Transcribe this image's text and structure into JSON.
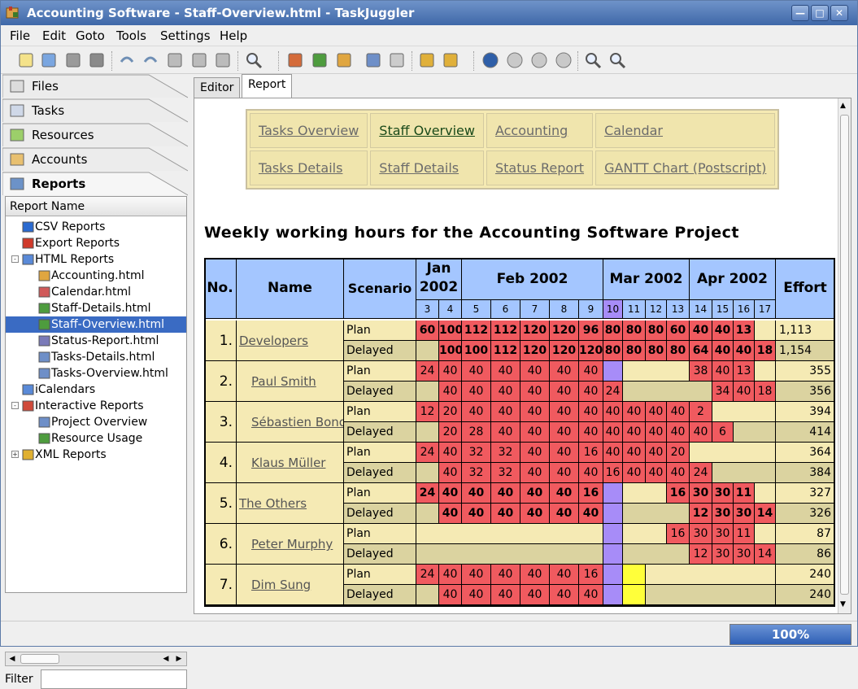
{
  "window": {
    "title": "Accounting Software - Staff-Overview.html - TaskJuggler",
    "buttons": [
      "—",
      "□",
      "✕"
    ]
  },
  "menu": [
    "File",
    "Edit",
    "Goto",
    "Tools",
    "Settings",
    "Help"
  ],
  "toolbar_icons": [
    "new-file",
    "open-file",
    "save",
    "print",
    "undo",
    "redo",
    "cut",
    "copy",
    "paste",
    "find",
    "tasks-view",
    "resources-view",
    "accounts-view",
    "report-view",
    "copy-report",
    "configure",
    "calendar",
    "schedule",
    "stop",
    "back",
    "forward",
    "zoom-in",
    "zoom-out"
  ],
  "left_tabs": [
    {
      "label": "Files",
      "icon": "files-icon"
    },
    {
      "label": "Tasks",
      "icon": "tasks-icon"
    },
    {
      "label": "Resources",
      "icon": "resources-icon"
    },
    {
      "label": "Accounts",
      "icon": "accounts-icon"
    },
    {
      "label": "Reports",
      "icon": "reports-icon",
      "active": true
    }
  ],
  "tree": {
    "header": "Report Name",
    "items": [
      {
        "label": "CSV Reports",
        "level": 1,
        "icon": "csv-icon"
      },
      {
        "label": "Export Reports",
        "level": 1,
        "icon": "export-icon"
      },
      {
        "label": "HTML Reports",
        "level": 1,
        "icon": "html-icon",
        "expander": "-"
      },
      {
        "label": "Accounting.html",
        "level": 2,
        "icon": "account-report-icon"
      },
      {
        "label": "Calendar.html",
        "level": 2,
        "icon": "calendar-report-icon"
      },
      {
        "label": "Staff-Details.html",
        "level": 2,
        "icon": "resource-report-icon"
      },
      {
        "label": "Staff-Overview.html",
        "level": 2,
        "icon": "resource-report-icon",
        "selected": true
      },
      {
        "label": "Status-Report.html",
        "level": 2,
        "icon": "status-report-icon"
      },
      {
        "label": "Tasks-Details.html",
        "level": 2,
        "icon": "task-report-icon"
      },
      {
        "label": "Tasks-Overview.html",
        "level": 2,
        "icon": "task-report-icon"
      },
      {
        "label": "iCalendars",
        "level": 1,
        "icon": "icalendar-icon"
      },
      {
        "label": "Interactive Reports",
        "level": 1,
        "icon": "interactive-icon",
        "expander": "-"
      },
      {
        "label": "Project Overview",
        "level": 2,
        "icon": "task-report-icon"
      },
      {
        "label": "Resource Usage",
        "level": 2,
        "icon": "resource-report-icon"
      },
      {
        "label": "XML Reports",
        "level": 1,
        "icon": "xml-icon",
        "expander": "+"
      }
    ]
  },
  "filter_label": "Filter",
  "right_tabs": [
    "Editor",
    "Report"
  ],
  "nav": [
    [
      "Tasks Overview",
      "Staff Overview",
      "Accounting",
      "Calendar"
    ],
    [
      "Tasks Details",
      "Staff Details",
      "Status Report",
      "GANTT Chart (Postscript)"
    ]
  ],
  "report": {
    "title": "Weekly working hours for the Accounting Software Project",
    "headers": {
      "no": "No.",
      "name": "Name",
      "scenario": "Scenario",
      "effort": "Effort"
    },
    "months": [
      {
        "label": "Jan 2002",
        "weeks": 2
      },
      {
        "label": "Feb 2002",
        "weeks": 5
      },
      {
        "label": "Mar 2002",
        "weeks": 4
      },
      {
        "label": "Apr 2002",
        "weeks": 4
      }
    ],
    "weeks": [
      "3",
      "4",
      "5",
      "6",
      "7",
      "8",
      "9",
      "10",
      "11",
      "12",
      "13",
      "14",
      "15",
      "16",
      "17"
    ],
    "current_week": "10",
    "rows": [
      {
        "no": "1.",
        "name": "Developers",
        "indent": false,
        "bold": true,
        "plan": {
          "cells": [
            "60",
            "100",
            "112",
            "112",
            "120",
            "120",
            "96",
            "80",
            "80",
            "80",
            "60",
            "40",
            "40",
            "13",
            ""
          ],
          "effort": "1,113"
        },
        "delayed": {
          "cells": [
            "",
            "100",
            "100",
            "112",
            "120",
            "120",
            "120",
            "80",
            "80",
            "80",
            "80",
            "64",
            "40",
            "40",
            "18"
          ],
          "effort": "1,154"
        }
      },
      {
        "no": "2.",
        "name": "Paul Smith",
        "indent": true,
        "bold": false,
        "plan": {
          "cells": [
            "24",
            "40",
            "40",
            "40",
            "40",
            "40",
            "40",
            "v",
            "",
            "",
            "",
            "38",
            "40",
            "13",
            ""
          ],
          "effort": "355"
        },
        "delayed": {
          "cells": [
            "",
            "40",
            "40",
            "40",
            "40",
            "40",
            "40",
            "24",
            "",
            "",
            "",
            "",
            "34",
            "40",
            "18"
          ],
          "effort": "356"
        }
      },
      {
        "no": "3.",
        "name": "Sébastien Bono",
        "indent": true,
        "bold": false,
        "plan": {
          "cells": [
            "12",
            "20",
            "40",
            "40",
            "40",
            "40",
            "40",
            "40",
            "40",
            "40",
            "40",
            "2",
            "",
            "",
            ""
          ],
          "effort": "394"
        },
        "delayed": {
          "cells": [
            "",
            "20",
            "28",
            "40",
            "40",
            "40",
            "40",
            "40",
            "40",
            "40",
            "40",
            "40",
            "6",
            "",
            ""
          ],
          "effort": "414"
        }
      },
      {
        "no": "4.",
        "name": "Klaus Müller",
        "indent": true,
        "bold": false,
        "plan": {
          "cells": [
            "24",
            "40",
            "32",
            "32",
            "40",
            "40",
            "16",
            "40",
            "40",
            "40",
            "20",
            "",
            "",
            "",
            ""
          ],
          "effort": "364"
        },
        "delayed": {
          "cells": [
            "",
            "40",
            "32",
            "32",
            "40",
            "40",
            "40",
            "16",
            "40",
            "40",
            "40",
            "24",
            "",
            "",
            ""
          ],
          "effort": "384"
        }
      },
      {
        "no": "5.",
        "name": "The Others",
        "indent": false,
        "bold": true,
        "plan": {
          "cells": [
            "24",
            "40",
            "40",
            "40",
            "40",
            "40",
            "16",
            "v",
            "",
            "",
            "16",
            "30",
            "30",
            "11",
            ""
          ],
          "effort": "327"
        },
        "delayed": {
          "cells": [
            "",
            "40",
            "40",
            "40",
            "40",
            "40",
            "40",
            "v",
            "",
            "",
            "",
            "12",
            "30",
            "30",
            "14"
          ],
          "effort": "326"
        }
      },
      {
        "no": "6.",
        "name": "Peter Murphy",
        "indent": true,
        "bold": false,
        "plan": {
          "cells": [
            "",
            "",
            "",
            "",
            "",
            "",
            "",
            "v",
            "",
            "",
            "16",
            "30",
            "30",
            "11",
            ""
          ],
          "effort": "87"
        },
        "delayed": {
          "cells": [
            "",
            "",
            "",
            "",
            "",
            "",
            "",
            "v",
            "",
            "",
            "",
            "12",
            "30",
            "30",
            "14"
          ],
          "effort": "86"
        }
      },
      {
        "no": "7.",
        "name": "Dim Sung",
        "indent": true,
        "bold": false,
        "plan": {
          "cells": [
            "24",
            "40",
            "40",
            "40",
            "40",
            "40",
            "16",
            "v",
            "y",
            "",
            "",
            "",
            "",
            "",
            ""
          ],
          "effort": "240"
        },
        "delayed": {
          "cells": [
            "",
            "40",
            "40",
            "40",
            "40",
            "40",
            "40",
            "v",
            "y",
            "",
            "",
            "",
            "",
            "",
            ""
          ],
          "effort": "240"
        }
      }
    ]
  },
  "colors": {
    "booked": "#f05a5f",
    "free_plan": "#f5eab4",
    "free_delayed": "#dbd3a0",
    "header": "#a4c6ff",
    "today": "#a78cf8",
    "vacation": "#ffff3a"
  },
  "status": {
    "progress": "100%"
  }
}
